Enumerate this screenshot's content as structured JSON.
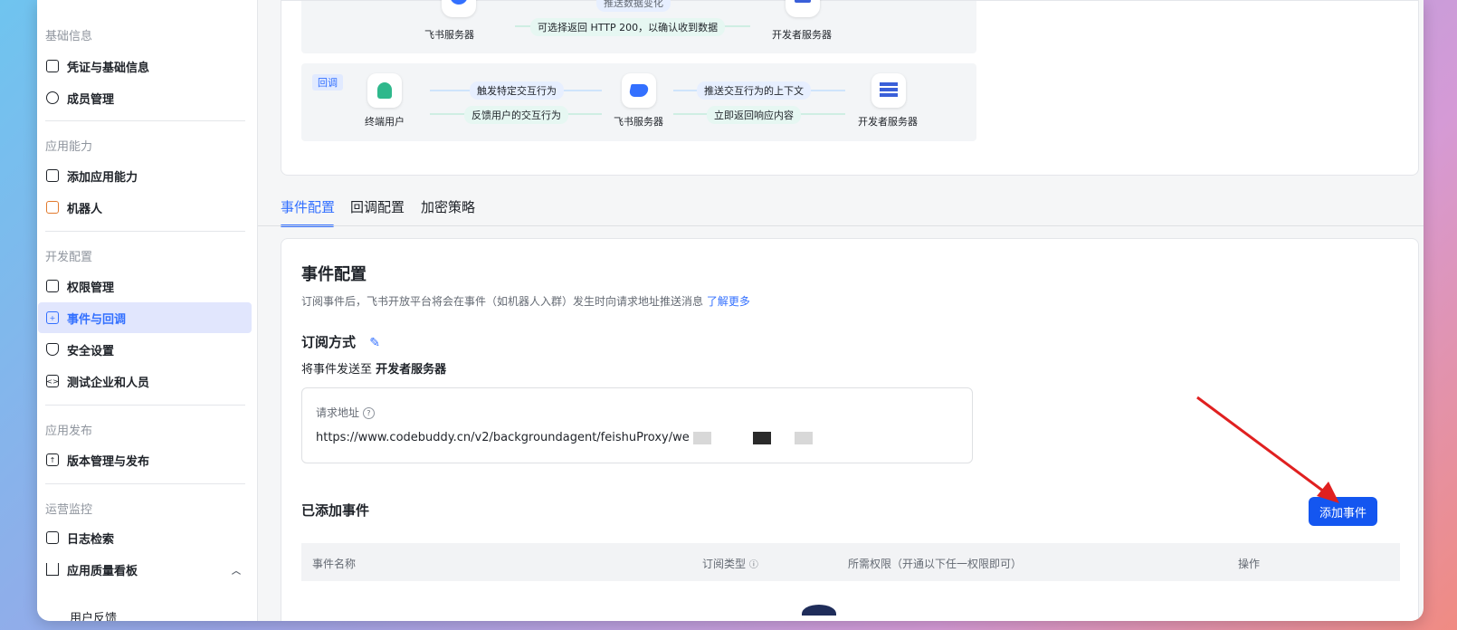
{
  "sidebar": {
    "sections": [
      {
        "title": "基础信息",
        "items": [
          "凭证与基础信息",
          "成员管理"
        ]
      },
      {
        "title": "应用能力",
        "items": [
          "添加应用能力",
          "机器人"
        ]
      },
      {
        "title": "开发配置",
        "items": [
          "权限管理",
          "事件与回调",
          "安全设置",
          "测试企业和人员"
        ]
      },
      {
        "title": "应用发布",
        "items": [
          "版本管理与发布"
        ]
      },
      {
        "title": "运营监控",
        "items": [
          "日志检索",
          "应用质量看板",
          "用户反馈"
        ]
      }
    ],
    "active_item": "事件与回调"
  },
  "diagram": {
    "top_row": {
      "left_label": "飞书服务器",
      "right_label": "开发者服务器",
      "top_pill": "推送数据变化",
      "return_pill": "可选择返回 HTTP 200，以确认收到数据"
    },
    "callback_row": {
      "tag": "回调",
      "user_label": "终端用户",
      "server_label": "飞书服务器",
      "dev_label": "开发者服务器",
      "pill_1": "触发特定交互行为",
      "pill_2": "反馈用户的交互行为",
      "pill_3": "推送交互行为的上下文",
      "pill_4": "立即返回响应内容"
    }
  },
  "tabs": [
    "事件配置",
    "回调配置",
    "加密策略"
  ],
  "event_config": {
    "title": "事件配置",
    "description": "订阅事件后，飞书开放平台将会在事件（如机器人入群）发生时向请求地址推送消息",
    "learn_more": "了解更多",
    "subscribe_title": "订阅方式",
    "send_to_prefix": "将事件发送至",
    "send_to_target": "开发者服务器",
    "url_label": "请求地址",
    "url_value": "https://www.codebuddy.cn/v2/backgroundagent/feishuProxy/we",
    "added_title": "已添加事件",
    "add_button": "添加事件",
    "columns": [
      "事件名称",
      "订阅类型",
      "所需权限（开通以下任一权限即可）",
      "操作"
    ]
  },
  "colors": {
    "accent": "#3370ff",
    "button": "#1456f0",
    "arrow": "#e02020"
  }
}
